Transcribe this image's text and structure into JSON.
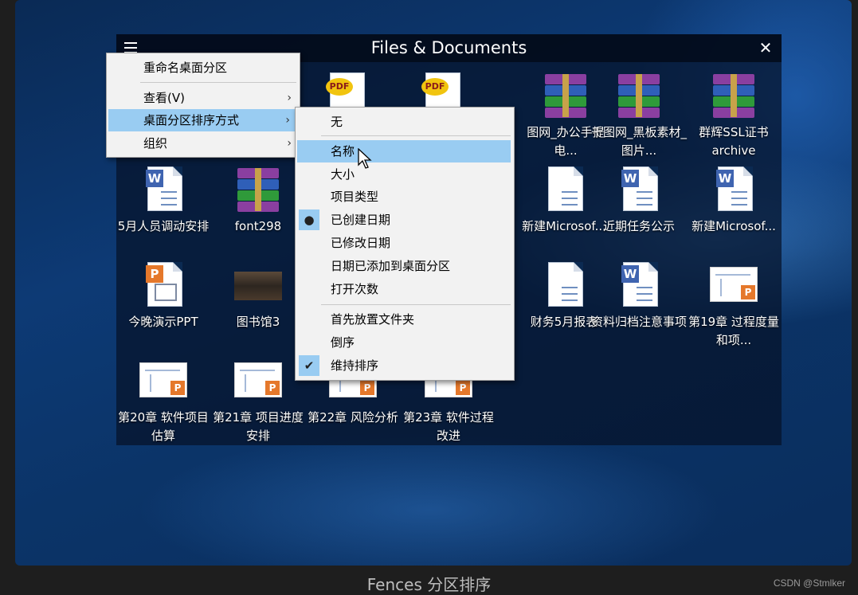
{
  "fence": {
    "title": "Files & Documents",
    "menu_icon": "hamburger-menu-icon",
    "close_icon": "close-icon",
    "close_glyph": "✕"
  },
  "items": [
    {
      "label": "",
      "icon": "pdf-icon"
    },
    {
      "label": "",
      "icon": "pdf-icon"
    },
    {
      "label": "图网_办公手提电...",
      "icon": "winrar-icon"
    },
    {
      "label": "千图网_黑板素材_图片...",
      "icon": "winrar-icon"
    },
    {
      "label": "群辉SSL证书archive",
      "icon": "winrar-icon"
    },
    {
      "label": "5月人员调动安排",
      "icon": "word-doc-icon"
    },
    {
      "label": "font298",
      "icon": "winrar-icon"
    },
    {
      "label": "新建Microsof...",
      "icon": "word-doc-icon"
    },
    {
      "label": "近期任务公示",
      "icon": "word-doc-icon"
    },
    {
      "label": "新建Microsof...",
      "icon": "word-doc-icon"
    },
    {
      "label": "今晚演示PPT",
      "icon": "powerpoint-icon"
    },
    {
      "label": "图书馆3",
      "icon": "photo-icon"
    },
    {
      "label": "财务5月报表",
      "icon": "word-doc-icon"
    },
    {
      "label": "资料归档注意事项",
      "icon": "word-doc-icon"
    },
    {
      "label": "第19章 过程度量和项...",
      "icon": "ppt-thumbnail-icon"
    },
    {
      "label": "第20章 软件项目估算",
      "icon": "ppt-thumbnail-icon"
    },
    {
      "label": "第21章 项目进度安排",
      "icon": "ppt-thumbnail-icon"
    },
    {
      "label": "第22章 风险分析",
      "icon": "ppt-thumbnail-icon"
    },
    {
      "label": "第23章 软件过程改进",
      "icon": "ppt-thumbnail-icon"
    }
  ],
  "main_menu": {
    "items": [
      {
        "label": "重命名桌面分区"
      },
      {
        "label": "查看(V)",
        "arrow": "›"
      },
      {
        "label": "桌面分区排序方式",
        "arrow": "›"
      },
      {
        "label": "组织",
        "arrow": "›"
      }
    ]
  },
  "sort_menu": {
    "items": [
      {
        "label": "无"
      },
      {
        "label": "名称"
      },
      {
        "label": "大小"
      },
      {
        "label": "项目类型"
      },
      {
        "label": "已创建日期",
        "mark": "●"
      },
      {
        "label": "已修改日期"
      },
      {
        "label": "日期已添加到桌面分区"
      },
      {
        "label": "打开次数"
      },
      {
        "label": "首先放置文件夹"
      },
      {
        "label": "倒序"
      },
      {
        "label": "维持排序",
        "mark": "✔"
      }
    ]
  },
  "caption": "Fences 分区排序",
  "credit": "CSDN @Stmlker",
  "colors": {
    "highlight": "#99ccf2",
    "menu_bg": "#f2f2f2",
    "word_blue": "#3f64b0",
    "ppt_orange": "#e5782b"
  }
}
